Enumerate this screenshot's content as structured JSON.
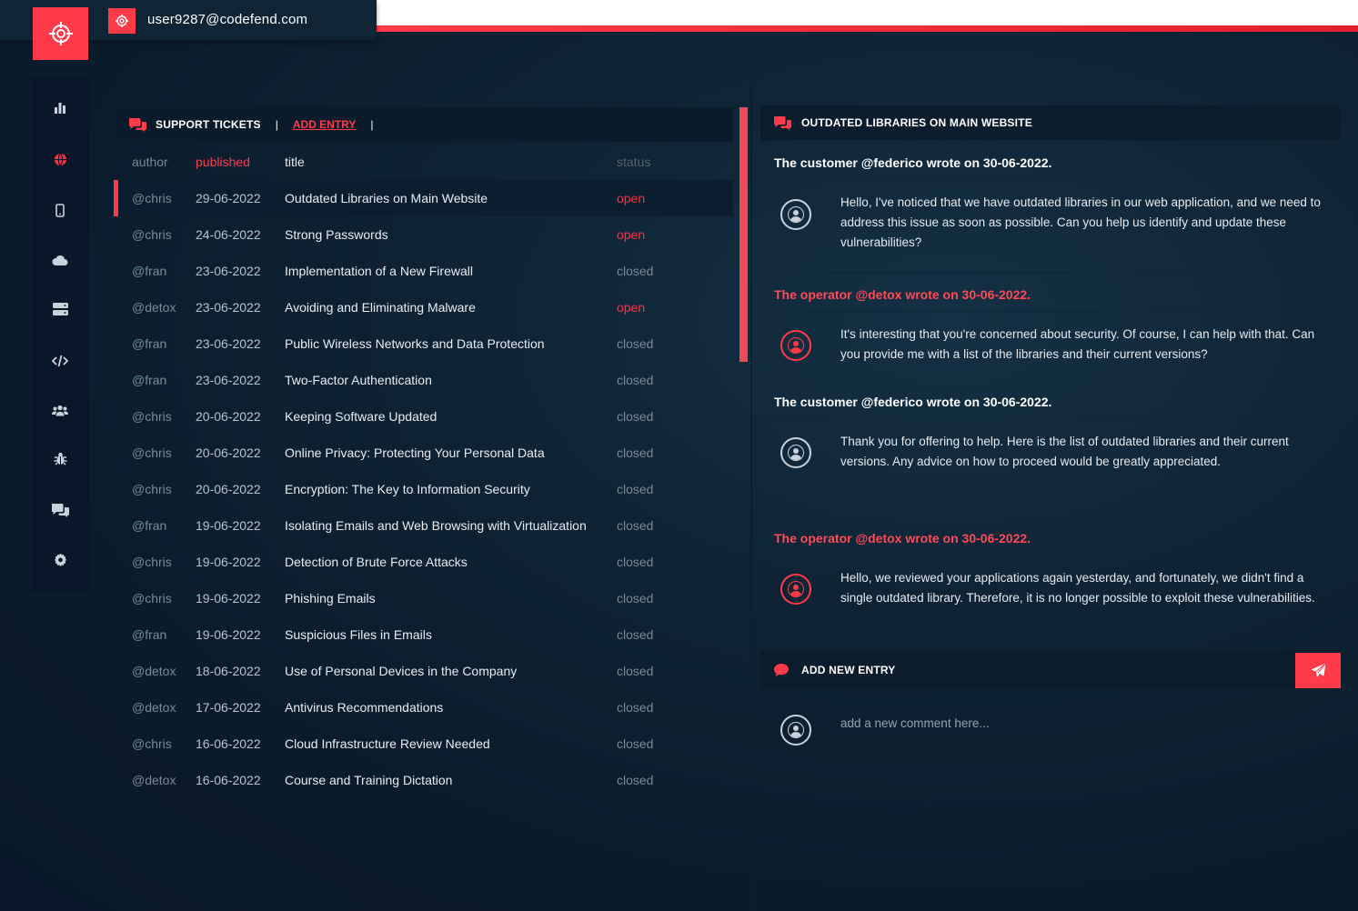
{
  "user": {
    "email": "user9287@codefend.com"
  },
  "brand": {
    "accent": "#ff3b4a",
    "background": "#0a1b2b"
  },
  "sidebar": {
    "items": [
      {
        "icon": "chart-icon",
        "active": false
      },
      {
        "icon": "globe-icon",
        "active": true
      },
      {
        "icon": "mobile-icon",
        "active": false
      },
      {
        "icon": "cloud-icon",
        "active": false
      },
      {
        "icon": "server-icon",
        "active": false
      },
      {
        "icon": "code-icon",
        "active": false
      },
      {
        "icon": "users-icon",
        "active": false
      },
      {
        "icon": "bug-icon",
        "active": false
      },
      {
        "icon": "chat-icon",
        "active": false
      },
      {
        "icon": "gear-icon",
        "active": false
      }
    ]
  },
  "tickets": {
    "title": "SUPPORT TICKETS",
    "separator": "|",
    "add_label": "ADD ENTRY",
    "columns": {
      "author": "author",
      "published": "published",
      "title": "title",
      "status": "status"
    },
    "rows": [
      {
        "author": "@chris",
        "date": "29-06-2022",
        "title": "Outdated Libraries on Main Website",
        "status": "open"
      },
      {
        "author": "@chris",
        "date": "24-06-2022",
        "title": "Strong Passwords",
        "status": "open"
      },
      {
        "author": "@fran",
        "date": "23-06-2022",
        "title": "Implementation of a New Firewall",
        "status": "closed"
      },
      {
        "author": "@detox",
        "date": "23-06-2022",
        "title": "Avoiding and Eliminating Malware",
        "status": "open"
      },
      {
        "author": "@fran",
        "date": "23-06-2022",
        "title": "Public Wireless Networks and Data Protection",
        "status": "closed"
      },
      {
        "author": "@fran",
        "date": "23-06-2022",
        "title": "Two-Factor Authentication",
        "status": "closed"
      },
      {
        "author": "@chris",
        "date": "20-06-2022",
        "title": "Keeping Software Updated",
        "status": "closed"
      },
      {
        "author": "@chris",
        "date": "20-06-2022",
        "title": "Online Privacy: Protecting Your Personal Data",
        "status": "closed"
      },
      {
        "author": "@chris",
        "date": "20-06-2022",
        "title": "Encryption: The Key to Information Security",
        "status": "closed"
      },
      {
        "author": "@fran",
        "date": "19-06-2022",
        "title": "Isolating Emails and Web Browsing with Virtualization",
        "status": "closed"
      },
      {
        "author": "@chris",
        "date": "19-06-2022",
        "title": "Detection of Brute Force Attacks",
        "status": "closed"
      },
      {
        "author": "@chris",
        "date": "19-06-2022",
        "title": "Phishing Emails",
        "status": "closed"
      },
      {
        "author": "@fran",
        "date": "19-06-2022",
        "title": "Suspicious Files in Emails",
        "status": "closed"
      },
      {
        "author": "@detox",
        "date": "18-06-2022",
        "title": "Use of Personal Devices in the Company",
        "status": "closed"
      },
      {
        "author": "@detox",
        "date": "17-06-2022",
        "title": "Antivirus Recommendations",
        "status": "closed"
      },
      {
        "author": "@chris",
        "date": "16-06-2022",
        "title": "Cloud Infrastructure Review Needed",
        "status": "closed"
      },
      {
        "author": "@detox",
        "date": "16-06-2022",
        "title": "Course and Training Dictation",
        "status": "closed"
      }
    ]
  },
  "detail": {
    "title": "OUTDATED LIBRARIES ON MAIN WEBSITE",
    "messages": [
      {
        "role": "customer",
        "author_line": "The customer @federico wrote on 30-06-2022.",
        "text": "Hello, I've noticed that we have outdated libraries in our web application, and we need to address this issue as soon as possible. Can you help us identify and update these vulnerabilities?"
      },
      {
        "role": "operator",
        "author_line": "The operator @detox wrote on 30-06-2022.",
        "text": "It's interesting that you're concerned about security. Of course, I can help with that. Can you provide me with a list of the libraries and their current versions?"
      },
      {
        "role": "customer",
        "author_line": "The customer @federico wrote on 30-06-2022.",
        "text": "Thank you for offering to help. Here is the list of outdated libraries and their current versions. Any advice on how to proceed would be greatly appreciated."
      },
      {
        "role": "operator",
        "author_line": "The operator @detox wrote on 30-06-2022.",
        "text": "Hello, we reviewed your applications again yesterday, and fortunately, we didn't find a single outdated library. Therefore, it is no longer possible to exploit these vulnerabilities."
      }
    ],
    "add_title": "ADD NEW ENTRY",
    "comment_placeholder": "add a new comment here...",
    "comment_value": ""
  }
}
